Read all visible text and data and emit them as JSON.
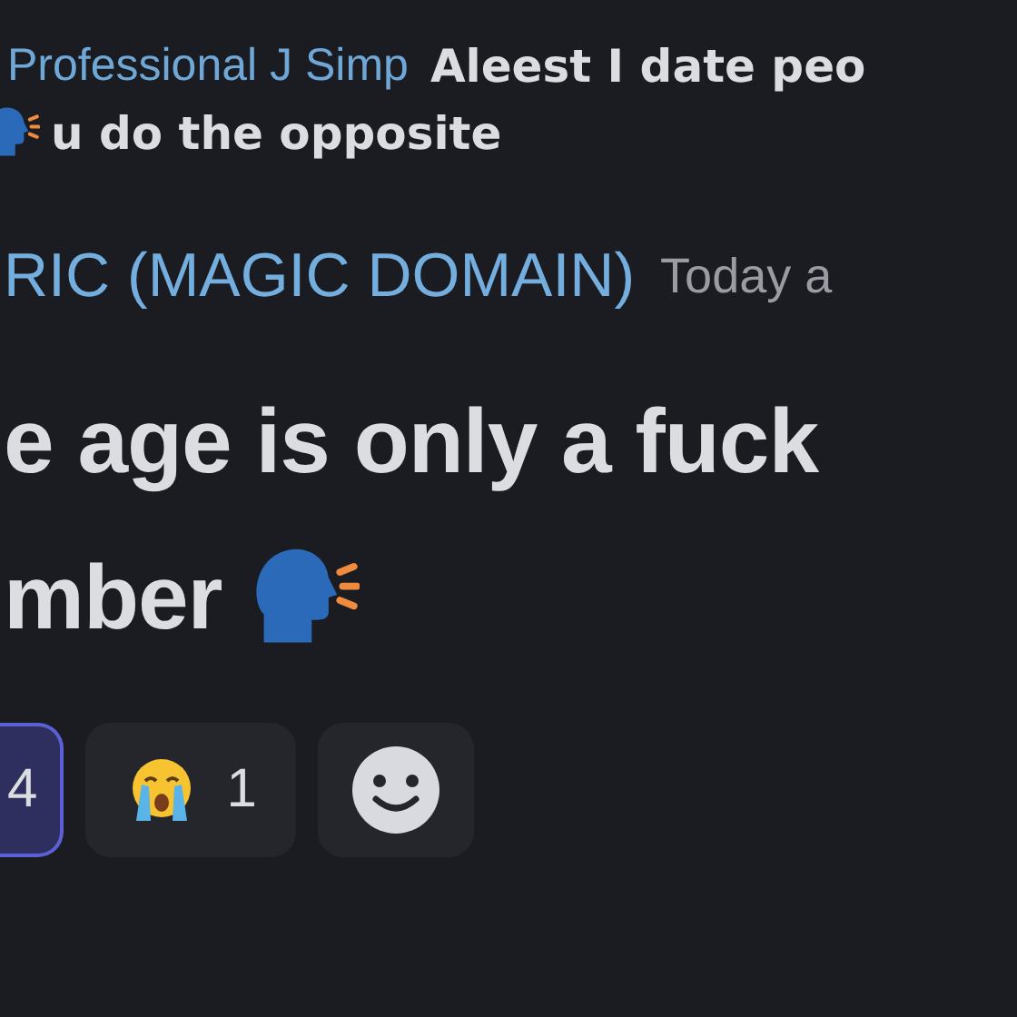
{
  "reply": {
    "author": "Professional J Simp",
    "text": "Aleest I date peo",
    "continuation": "u do the opposite"
  },
  "message": {
    "author": "RIC (MAGIC DOMAIN)",
    "timestamp": "Today a",
    "lines": [
      "e age is only a fuck",
      "mber"
    ]
  },
  "reactions": [
    {
      "kind": "partial",
      "count": "4",
      "selected": true
    },
    {
      "kind": "crying",
      "count": "1",
      "selected": false
    }
  ],
  "add_reaction": {
    "kind": "smiley"
  }
}
